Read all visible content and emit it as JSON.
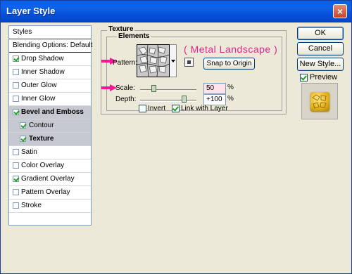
{
  "window": {
    "title": "Layer Style",
    "close_glyph": "×"
  },
  "styles_list": {
    "items": [
      {
        "label": "Styles"
      },
      {
        "label": "Blending Options: Default"
      },
      {
        "label": "Drop Shadow",
        "checked": true
      },
      {
        "label": "Inner Shadow",
        "checked": false
      },
      {
        "label": "Outer Glow",
        "checked": false
      },
      {
        "label": "Inner Glow",
        "checked": false
      },
      {
        "label": "Bevel and Emboss",
        "checked": true
      },
      {
        "label": "Contour",
        "checked": true
      },
      {
        "label": "Texture",
        "checked": true
      },
      {
        "label": "Satin",
        "checked": false
      },
      {
        "label": "Color Overlay",
        "checked": false
      },
      {
        "label": "Gradient Overlay",
        "checked": true
      },
      {
        "label": "Pattern Overlay",
        "checked": false
      },
      {
        "label": "Stroke",
        "checked": false
      }
    ]
  },
  "texture": {
    "group_label": "Texture",
    "elements_label": "Elements",
    "pattern_label": "Pattern:",
    "pattern_name_annotation": "( Metal Landscape )",
    "snap_button": "Snap to Origin",
    "scale_label": "Scale:",
    "scale_value": "50",
    "scale_unit": "%",
    "depth_label": "Depth:",
    "depth_value": "+100",
    "depth_unit": "%",
    "invert_label": "Invert",
    "invert_checked": false,
    "link_label": "Link with Layer",
    "link_checked": true
  },
  "buttons": {
    "ok": "OK",
    "cancel": "Cancel",
    "new_style": "New Style..."
  },
  "preview": {
    "label": "Preview",
    "checked": true
  },
  "colors": {
    "titlebar": "#0a5fe8",
    "annotation": "#e0228f",
    "arrow": "#ff1493",
    "selection": "#c6c8d2"
  }
}
